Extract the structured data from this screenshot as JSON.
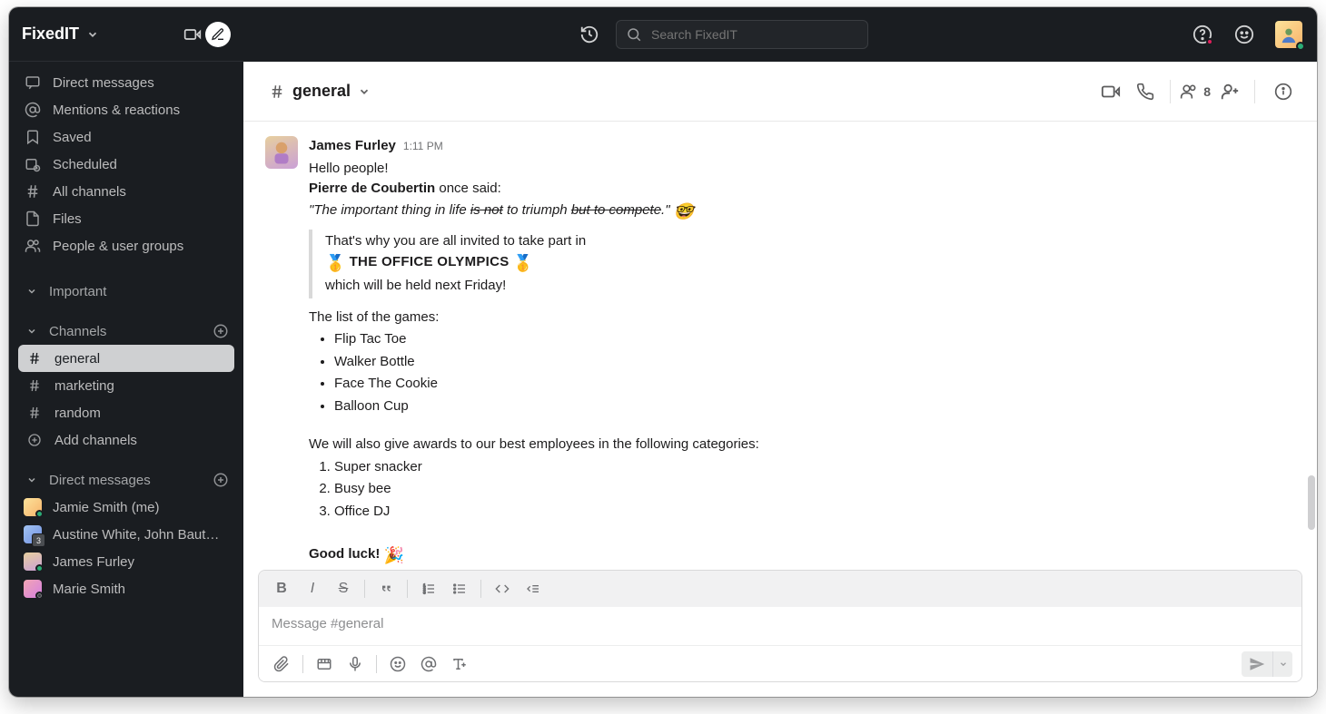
{
  "workspace": {
    "name": "FixedIT"
  },
  "search": {
    "placeholder": "Search FixedIT"
  },
  "nav": {
    "dms": "Direct messages",
    "mentions": "Mentions & reactions",
    "saved": "Saved",
    "scheduled": "Scheduled",
    "all_channels": "All channels",
    "files": "Files",
    "people": "People & user groups"
  },
  "sections": {
    "important": "Important",
    "channels": "Channels",
    "dms": "Direct messages",
    "add_channels": "Add channels"
  },
  "channels": {
    "general": "general",
    "marketing": "marketing",
    "random": "random"
  },
  "dms": {
    "jamie": "Jamie Smith (me)",
    "austine": "Austine White, John Baut…",
    "james": "James Furley",
    "marie": "Marie Smith"
  },
  "channelHeader": {
    "name": "general",
    "memberCount": "8"
  },
  "message": {
    "author": "James Furley",
    "time": "1:11 PM",
    "line1": "Hello people!",
    "coubertin": "Pierre de Coubertin",
    "once_said": " once said:",
    "quote_prefix": "\"The important thing in life ",
    "quote_strike1": "is not",
    "quote_mid": " to triumph ",
    "quote_strike2": "but to compete",
    "quote_suffix": ".\"",
    "invite_line": "That's why you are all invited to take part in",
    "olympics": "THE OFFICE OLYMPICS",
    "when": "which will be held next Friday!",
    "games_head": "The list of the games:",
    "games": [
      "Flip Tac Toe",
      "Walker Bottle",
      "Face The Cookie",
      "Balloon Cup"
    ],
    "awards_head": "We will also give awards to our best employees in the following categories:",
    "awards": [
      "Super snacker",
      "Busy bee",
      "Office DJ"
    ],
    "goodluck": "Good luck!"
  },
  "composer": {
    "placeholder": "Message #general"
  }
}
